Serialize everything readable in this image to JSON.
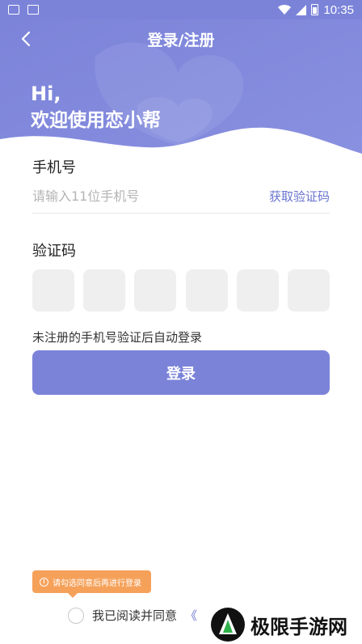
{
  "status_bar": {
    "time": "10:35"
  },
  "nav": {
    "title": "登录/注册"
  },
  "greeting": {
    "hi": "Hi,",
    "welcome": "欢迎使用恋小帮"
  },
  "phone": {
    "label": "手机号",
    "placeholder": "请输入11位手机号",
    "get_code_label": "获取验证码"
  },
  "code": {
    "label": "验证码",
    "boxes": [
      "",
      "",
      "",
      "",
      "",
      ""
    ]
  },
  "hint": "未注册的手机号验证后自动登录",
  "login_button": "登录",
  "tooltip": "请勾选同意后再进行登录",
  "agreement": {
    "text": "我已阅读并同意",
    "link": "《"
  },
  "watermark": {
    "text": "极限手游网"
  },
  "colors": {
    "primary": "#7b83d9",
    "link": "#6a74cf",
    "tooltip": "#f6a15a"
  },
  "icons": [
    "back-icon",
    "wifi-icon",
    "signal-icon",
    "battery-icon",
    "info-icon"
  ]
}
